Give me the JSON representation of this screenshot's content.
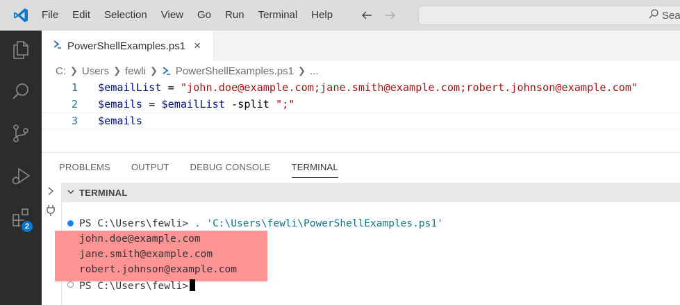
{
  "menu": [
    "File",
    "Edit",
    "Selection",
    "View",
    "Go",
    "Run",
    "Terminal",
    "Help"
  ],
  "search": {
    "text": "Sea"
  },
  "activity": {
    "extensions_badge": "2"
  },
  "editor": {
    "tab": {
      "label": "PowerShellExamples.ps1",
      "close": "×"
    },
    "breadcrumb": [
      "C:",
      "Users",
      "fewli",
      "PowerShellExamples.ps1",
      "..."
    ],
    "lines": [
      {
        "num": "1",
        "var": "$emailList",
        "op": " = ",
        "str": "\"john.doe@example.com;jane.smith@example.com;robert.johnson@example.com\""
      },
      {
        "num": "2",
        "var1": "$emails",
        "op1": " = ",
        "var2": "$emailList",
        "op2": " -split ",
        "str": "\";\""
      },
      {
        "num": "3",
        "var": "$emails"
      }
    ]
  },
  "panel": {
    "tabs": [
      "PROBLEMS",
      "OUTPUT",
      "DEBUG CONSOLE",
      "TERMINAL"
    ],
    "active_tab": "TERMINAL",
    "terminal_title": "TERMINAL",
    "command_prompt": "PS C:\\Users\\fewli> ",
    "command_text": ". 'C:\\Users\\fewli\\PowerShellExamples.ps1'",
    "output": [
      "john.doe@example.com",
      "jane.smith@example.com",
      "robert.johnson@example.com"
    ],
    "idle_prompt": "PS C:\\Users\\fewli>"
  },
  "colors": {
    "activity_bar": "#2c2c2c",
    "titlebar": "#dddddd",
    "accent": "#0078d4",
    "highlight": "#ff9494",
    "string": "#a31515",
    "variable": "#001080",
    "line_number": "#237893"
  },
  "icons": [
    "vscode-logo-icon",
    "back-arrow-icon",
    "forward-arrow-icon",
    "search-icon",
    "explorer-icon",
    "search-view-icon",
    "source-control-icon",
    "run-debug-icon",
    "extensions-icon",
    "powershell-icon",
    "chevron-right-icon",
    "plug-icon",
    "chevron-down-icon"
  ]
}
